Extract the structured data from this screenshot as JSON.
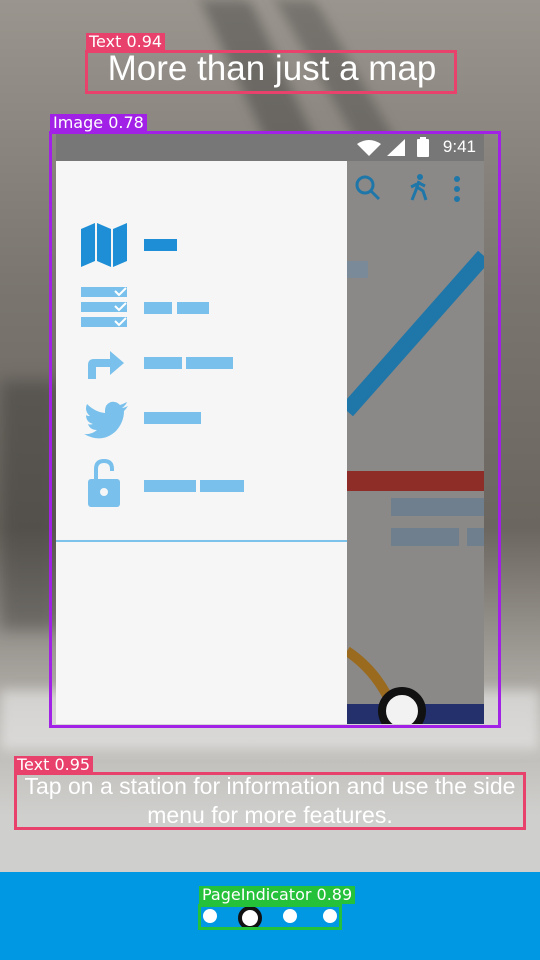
{
  "colors": {
    "text_box": "#e8416c",
    "image_box": "#a221e6",
    "indicator_box": "#26c13a",
    "footer": "#0198e3",
    "drawer_accent": "#79c1ec"
  },
  "annotations": {
    "title_tag": "Text 0.94",
    "image_tag": "Image 0.78",
    "desc_tag": "Text 0.95",
    "indicator_tag": "PageIndicator 0.89"
  },
  "onboarding": {
    "title": "More than just a map",
    "description": "Tap on a station for information and use the side menu for more features."
  },
  "phone": {
    "status_time": "9:41",
    "status_icons": [
      "wifi-icon",
      "signal-icon",
      "battery-icon"
    ],
    "toolbar_icons": [
      "search-icon",
      "walking-icon",
      "more-vert-icon"
    ],
    "drawer_items": [
      "map-icon",
      "checklist-icon",
      "share-arrow-icon",
      "twitter-icon",
      "lock-open-icon"
    ]
  },
  "page_indicator": {
    "count": 4,
    "active_index": 1
  }
}
